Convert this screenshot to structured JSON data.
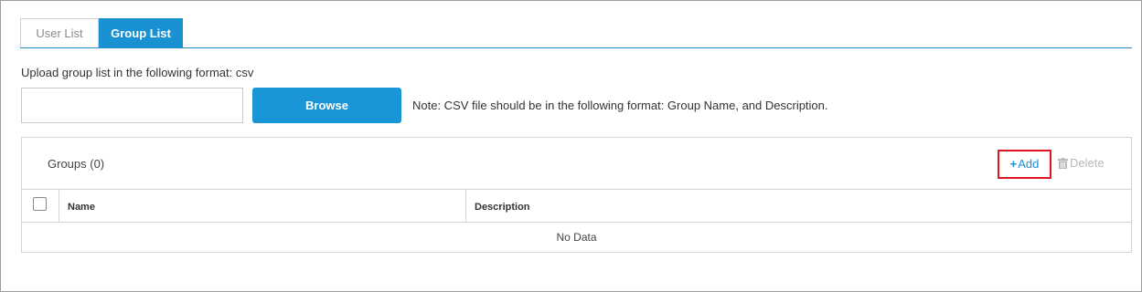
{
  "tabs": [
    {
      "label": "User List",
      "active": false
    },
    {
      "label": "Group List",
      "active": true
    }
  ],
  "upload": {
    "label": "Upload group list in the following format: csv",
    "file_value": "",
    "browse_label": "Browse",
    "note": "Note: CSV file should be in the following format: Group Name, and Description."
  },
  "groups": {
    "title": "Groups (0)",
    "add_label": "Add",
    "delete_label": "Delete",
    "columns": [
      "Name",
      "Description"
    ],
    "rows": [],
    "empty_text": "No Data"
  },
  "colors": {
    "accent": "#1a96d8",
    "highlight_border": "#e0141e",
    "disabled": "#b9b9b9"
  },
  "icons": {
    "add": "plus-icon",
    "delete": "trash-icon"
  }
}
